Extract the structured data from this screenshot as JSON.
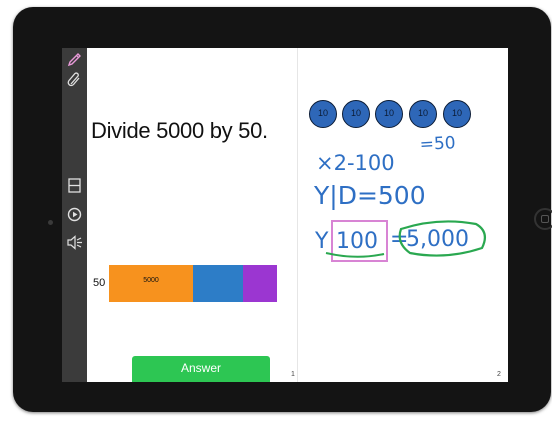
{
  "question": "Divide 5000 by 50.",
  "bar": {
    "label": "50",
    "segments": [
      {
        "label": "5000",
        "color": "#f7921e"
      },
      {
        "label": "",
        "color": "#2d7dc7"
      },
      {
        "label": "",
        "color": "#9b36d1"
      }
    ]
  },
  "answer_button": "Answer",
  "page_numbers": [
    "1",
    "2"
  ],
  "coins": [
    "10",
    "10",
    "10",
    "10",
    "10"
  ],
  "handwriting": {
    "line1": "=50",
    "line2": "×2-100",
    "line3": "Y|D=500",
    "line4_prefix": "Y",
    "line4_boxed": "100",
    "line4_equals": "=",
    "line4_circled": "5,000"
  },
  "toolbar_icons": [
    "pencil-icon",
    "paperclip-icon",
    "layout-icon",
    "play-icon",
    "speaker-icon"
  ],
  "colors": {
    "ink": "#2e6fc4",
    "box": "#d884d4",
    "circle": "#2aa850",
    "underline": "#2aa850",
    "answer": "#2dc653"
  }
}
